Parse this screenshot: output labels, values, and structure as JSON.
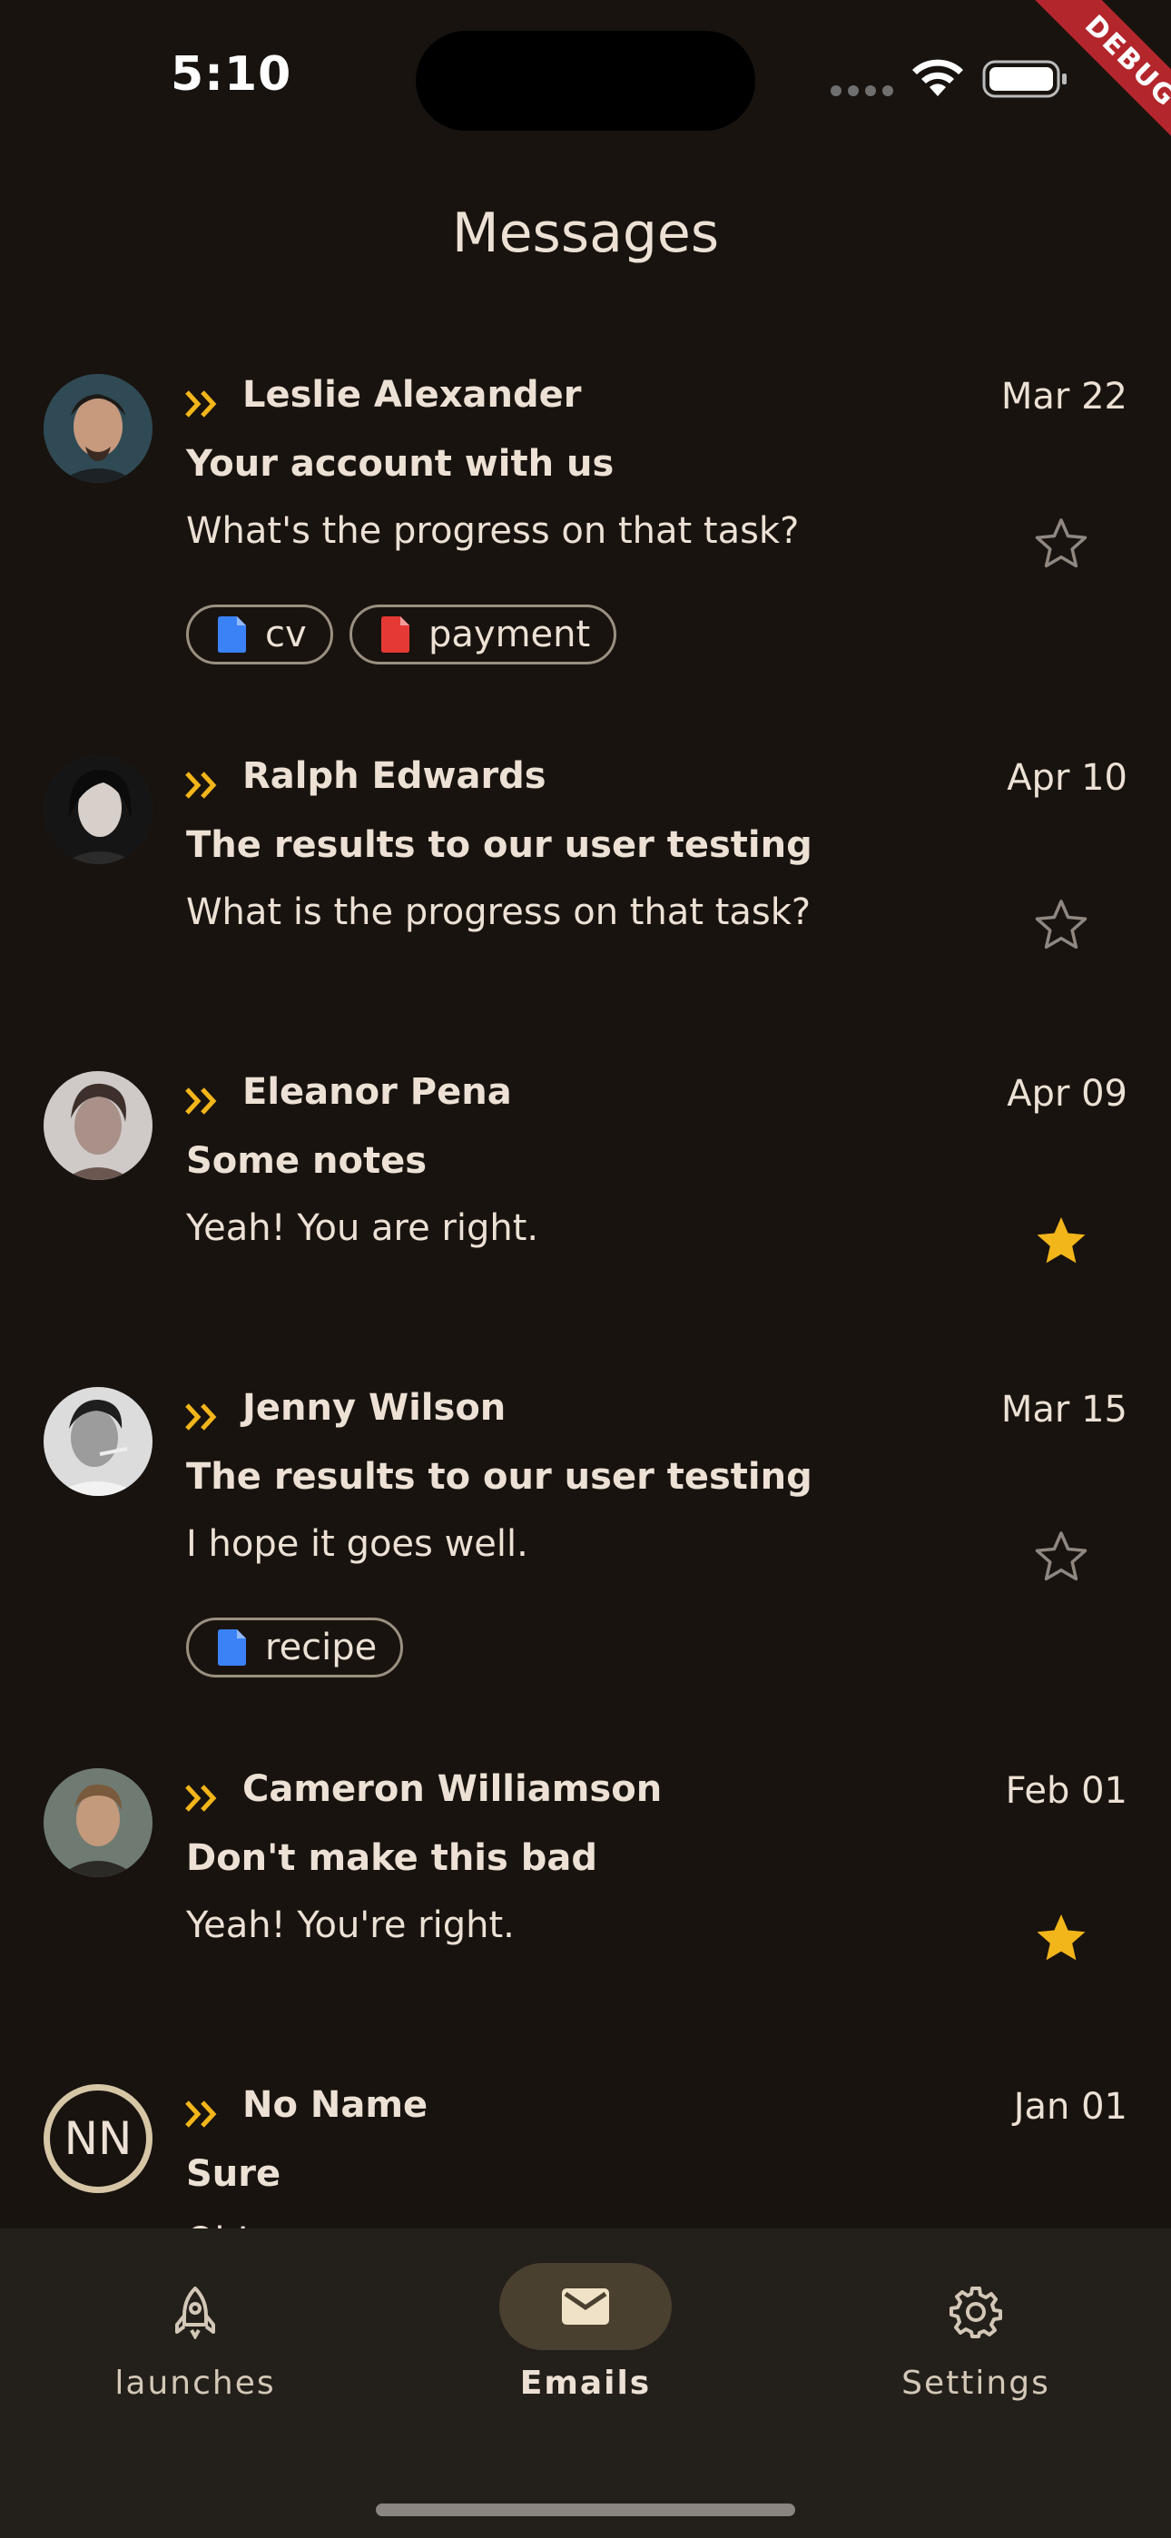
{
  "status_bar": {
    "time": "5:10",
    "debug_label": "DEBUG"
  },
  "header": {
    "title": "Messages"
  },
  "colors": {
    "background": "#18130f",
    "accent_yellow": "#f2b51a",
    "chip_doc_blue": "#3b82f6",
    "chip_doc_red": "#e53935",
    "nav_background": "#231f1a",
    "nav_active_pill": "#4a4030"
  },
  "emails": [
    {
      "sender": "Leslie Alexander",
      "date": "Mar 22",
      "subject": "Your account with us",
      "preview": "What's the progress on that task?",
      "starred": false,
      "attachments": [
        {
          "label": "cv",
          "icon": "file-icon",
          "color": "#3b82f6"
        },
        {
          "label": "payment",
          "icon": "file-icon",
          "color": "#e53935"
        }
      ]
    },
    {
      "sender": "Ralph Edwards",
      "date": "Apr 10",
      "subject": "The results to our user testing",
      "preview": "What is the progress on that task?",
      "starred": false,
      "attachments": []
    },
    {
      "sender": "Eleanor Pena",
      "date": "Apr 09",
      "subject": "Some notes",
      "preview": "Yeah! You are right.",
      "starred": true,
      "attachments": []
    },
    {
      "sender": "Jenny Wilson",
      "date": "Mar 15",
      "subject": "The results to our user testing",
      "preview": "I hope it goes well.",
      "starred": false,
      "attachments": [
        {
          "label": "recipe",
          "icon": "file-icon",
          "color": "#3b82f6"
        }
      ]
    },
    {
      "sender": "Cameron Williamson",
      "date": "Feb 01",
      "subject": "Don't make this bad",
      "preview": "Yeah! You're right.",
      "starred": true,
      "attachments": []
    },
    {
      "sender": "No Name",
      "date": "Jan 01",
      "subject": "Sure",
      "preview": "Ok!",
      "starred": true,
      "attachments": [],
      "avatar_initials": "NN"
    }
  ],
  "bottom_nav": {
    "items": [
      {
        "label": "launches",
        "icon": "rocket-icon",
        "active": false
      },
      {
        "label": "Emails",
        "icon": "mail-icon",
        "active": true
      },
      {
        "label": "Settings",
        "icon": "gear-icon",
        "active": false
      }
    ]
  }
}
